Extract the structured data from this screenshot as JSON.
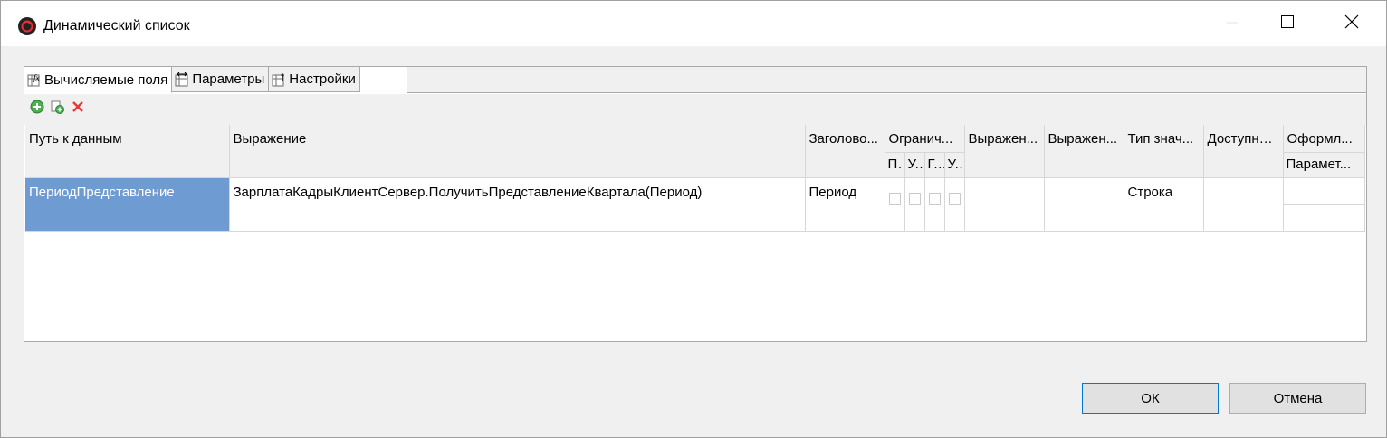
{
  "window": {
    "title": "Динамический список",
    "icon": "app-logo-icon",
    "controls": [
      "minimize-icon",
      "maximize-icon",
      "close-icon"
    ]
  },
  "tabs": [
    {
      "label": "Вычисляемые поля",
      "icon": "calculated-fields-icon",
      "active": true
    },
    {
      "label": "Параметры",
      "icon": "parameters-icon",
      "active": false
    },
    {
      "label": "Настройки",
      "icon": "settings-icon",
      "active": false
    }
  ],
  "toolbar": {
    "buttons": [
      "add-icon",
      "copy-icon",
      "delete-icon"
    ]
  },
  "grid": {
    "headers": {
      "path": "Путь к данным",
      "expression": "Выражение",
      "title": "Заголово...",
      "restrictions": "Огранич...",
      "restriction_sub": [
        "П...",
        "У...",
        "Г...",
        "У..."
      ],
      "expr2": "Выражен...",
      "expr3": "Выражен...",
      "value_type": "Тип знач...",
      "available": "Доступны...",
      "appearance": "Оформл...",
      "appearance_sub": "Парамет..."
    },
    "rows": [
      {
        "path": "ПериодПредставление",
        "expression": "ЗарплатаКадрыКлиентСервер.ПолучитьПредставлениеКвартала(Период)",
        "title": "Период",
        "value_type": "Строка",
        "selected": true
      }
    ]
  },
  "buttons": {
    "ok": "ОК",
    "cancel": "Отмена"
  },
  "colors": {
    "selection": "#6e9bd2",
    "default_button_border": "#0078d7"
  }
}
